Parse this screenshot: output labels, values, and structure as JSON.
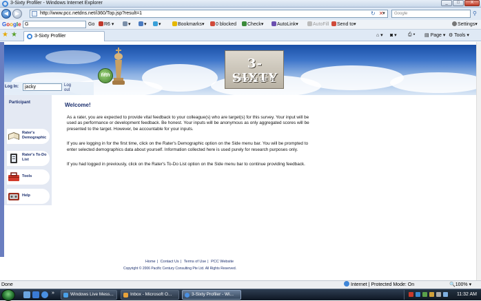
{
  "window": {
    "title": "3-Sixty Profiler - Windows Internet Explorer",
    "min": "_",
    "max": "□",
    "close": "X"
  },
  "address": {
    "url": "http://www.pcc.netdns.net/i360/Top.jsp?result=1",
    "search_placeholder": "Google"
  },
  "google_toolbar": {
    "search_value": "G",
    "go": "Go",
    "bookmarks": "Bookmarks",
    "blocked": "0 blocked",
    "check": "Check",
    "autolink": "AutoLink",
    "autofill": "AutoFill",
    "sendto": "Send to",
    "settings": "Settings"
  },
  "tab": {
    "label": "3-Sixty Profiler"
  },
  "commands": {
    "page": "Page",
    "tools": "Tools"
  },
  "banner": {
    "logo_main": "3-SIXTY",
    "logo_sub": "PROFILER",
    "emblem": "fifth"
  },
  "login": {
    "label": "Log In:",
    "username": "jacky",
    "logout": "Log out"
  },
  "sidebar": {
    "heading": "Participant",
    "items": [
      {
        "label": "Rater's Demographic",
        "icon": "book-icon"
      },
      {
        "label": "Rater's To-Do List",
        "icon": "clipboard-icon"
      },
      {
        "label": "Tools",
        "icon": "toolbox-icon"
      },
      {
        "label": "Help",
        "icon": "help-icon"
      }
    ]
  },
  "content": {
    "heading": "Welcome!",
    "p1": "As a rater, you are expected to provide vital feedback to your colleague(s) who are target(s) for this survey. Your input will be used as performance or development feedback. Be honest. Your inputs will be anonymous as only aggregated scores will be presented to the target. However, be accountable for your inputs.",
    "p2": "If you are logging in for the first time, click on the Rater's Demographic option on the Side menu bar. You will be prompted to enter selected demographics data about yourself. Information collected here is used purely for research purposes only.",
    "p3": "If you had logged in previously, click on the Rater's To-Do List option on the Side menu bar to continue providing feedback."
  },
  "footer": {
    "links": [
      "Home",
      "Contact Us",
      "Terms of Use",
      "PCC Website"
    ],
    "separator": "|",
    "copyright": "Copyright © 2006 Pacific Century Consulting Pte Ltd. All Rights Reserved."
  },
  "status": {
    "text": "Done",
    "zone": "Internet | Protected Mode: On",
    "zoom": "100%"
  },
  "taskbar": {
    "buttons": [
      "Windows Live Mess...",
      "Inbox - Microsoft O...",
      "3-Sixty Profiler - Wi..."
    ],
    "time": "11:32 AM"
  }
}
